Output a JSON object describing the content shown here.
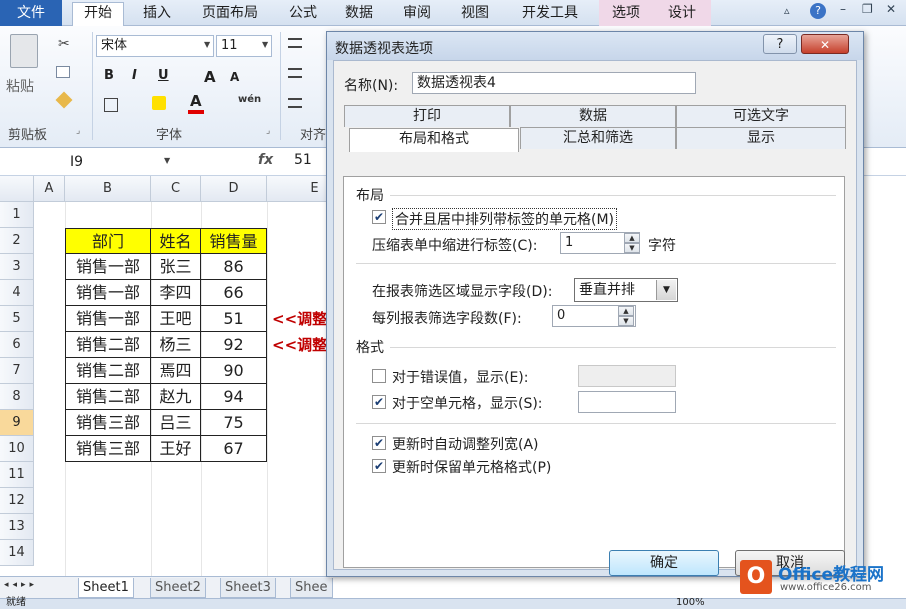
{
  "ribbon": {
    "tabs": [
      "文件",
      "开始",
      "插入",
      "页面布局",
      "公式",
      "数据",
      "审阅",
      "视图",
      "开发工具",
      "选项",
      "设计"
    ],
    "font_name": "宋体",
    "font_size": "11",
    "paste_label": "粘贴",
    "clipboard_label": "剪贴板",
    "font_group_label": "字体",
    "align_group_label": "对齐",
    "bold": "B",
    "italic": "I",
    "underline": "U",
    "grow_font": "A",
    "shrink_font": "A",
    "wen": "wén"
  },
  "formula_bar": {
    "name_box": "I9",
    "fx": "fx",
    "value": "51"
  },
  "grid": {
    "columns": [
      "A",
      "B",
      "C",
      "D",
      "E"
    ],
    "rows": [
      "1",
      "2",
      "3",
      "4",
      "5",
      "6",
      "7",
      "8",
      "9",
      "10",
      "11",
      "12",
      "13",
      "14"
    ],
    "selected_row": "9",
    "table": {
      "headers": [
        "部门",
        "姓名",
        "销售量"
      ],
      "rows": [
        [
          "销售一部",
          "张三",
          "86"
        ],
        [
          "销售一部",
          "李四",
          "66"
        ],
        [
          "销售一部",
          "王吧",
          "51"
        ],
        [
          "销售二部",
          "杨三",
          "92"
        ],
        [
          "销售二部",
          "焉四",
          "90"
        ],
        [
          "销售二部",
          "赵九",
          "94"
        ],
        [
          "销售三部",
          "吕三",
          "75"
        ],
        [
          "销售三部",
          "王好",
          "67"
        ]
      ]
    },
    "annotations": [
      "<<调整",
      "<<调整"
    ]
  },
  "sheets": [
    "Sheet1",
    "Sheet2",
    "Sheet3",
    "Shee"
  ],
  "status": {
    "ready": "就绪",
    "zoom": "100%"
  },
  "dialog": {
    "title": "数据透视表选项",
    "help": "?",
    "close": "✕",
    "name_label": "名称(N):",
    "name_value": "数据透视表4",
    "tabs_row1": [
      "打印",
      "数据",
      "可选文字"
    ],
    "tabs_row2": [
      "布局和格式",
      "汇总和筛选",
      "显示"
    ],
    "layout_section": "布局",
    "merge_center_label": "合并且居中排列带标签的单元格(M)",
    "merge_center_checked": true,
    "indent_label": "压缩表单中缩进行标签(C):",
    "indent_value": "1",
    "indent_unit": "字符",
    "filter_display_label": "在报表筛选区域显示字段(D):",
    "filter_display_value": "垂直并排",
    "filter_fields_label": "每列报表筛选字段数(F):",
    "filter_fields_value": "0",
    "format_section": "格式",
    "error_label": "对于错误值，显示(E):",
    "error_checked": false,
    "empty_label": "对于空单元格，显示(S):",
    "empty_checked": true,
    "autofit_label": "更新时自动调整列宽(A)",
    "autofit_checked": true,
    "preserve_label": "更新时保留单元格格式(P)",
    "preserve_checked": true,
    "ok": "确定",
    "cancel": "取消"
  },
  "watermark": {
    "brand": "Office教程网",
    "url": "www.office26.com"
  }
}
